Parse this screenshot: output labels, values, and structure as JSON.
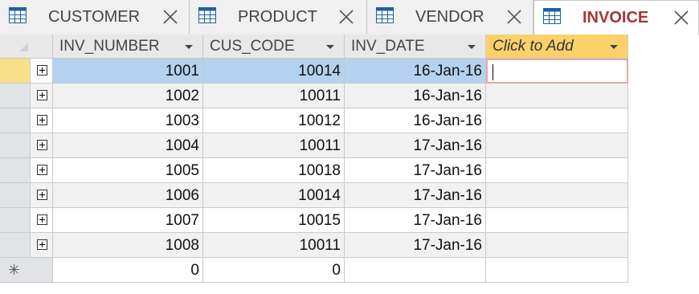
{
  "tabs": [
    {
      "label": "CUSTOMER",
      "active": false
    },
    {
      "label": "PRODUCT",
      "active": false
    },
    {
      "label": "VENDOR",
      "active": false
    },
    {
      "label": "INVOICE",
      "active": true
    }
  ],
  "columns": [
    "INV_NUMBER",
    "CUS_CODE",
    "INV_DATE",
    "Click to Add"
  ],
  "rows": [
    {
      "inv_number": "1001",
      "cus_code": "10014",
      "inv_date": "16-Jan-16"
    },
    {
      "inv_number": "1002",
      "cus_code": "10011",
      "inv_date": "16-Jan-16"
    },
    {
      "inv_number": "1003",
      "cus_code": "10012",
      "inv_date": "16-Jan-16"
    },
    {
      "inv_number": "1004",
      "cus_code": "10011",
      "inv_date": "17-Jan-16"
    },
    {
      "inv_number": "1005",
      "cus_code": "10018",
      "inv_date": "17-Jan-16"
    },
    {
      "inv_number": "1006",
      "cus_code": "10014",
      "inv_date": "17-Jan-16"
    },
    {
      "inv_number": "1007",
      "cus_code": "10015",
      "inv_date": "17-Jan-16"
    },
    {
      "inv_number": "1008",
      "cus_code": "10011",
      "inv_date": "17-Jan-16"
    }
  ],
  "new_record": {
    "inv_number": "0",
    "cus_code": "0",
    "symbol": "✳"
  },
  "colors": {
    "active_tab_text": "#a4373a",
    "selection": "#b5d2ee",
    "add_column": "#fbd26a"
  }
}
